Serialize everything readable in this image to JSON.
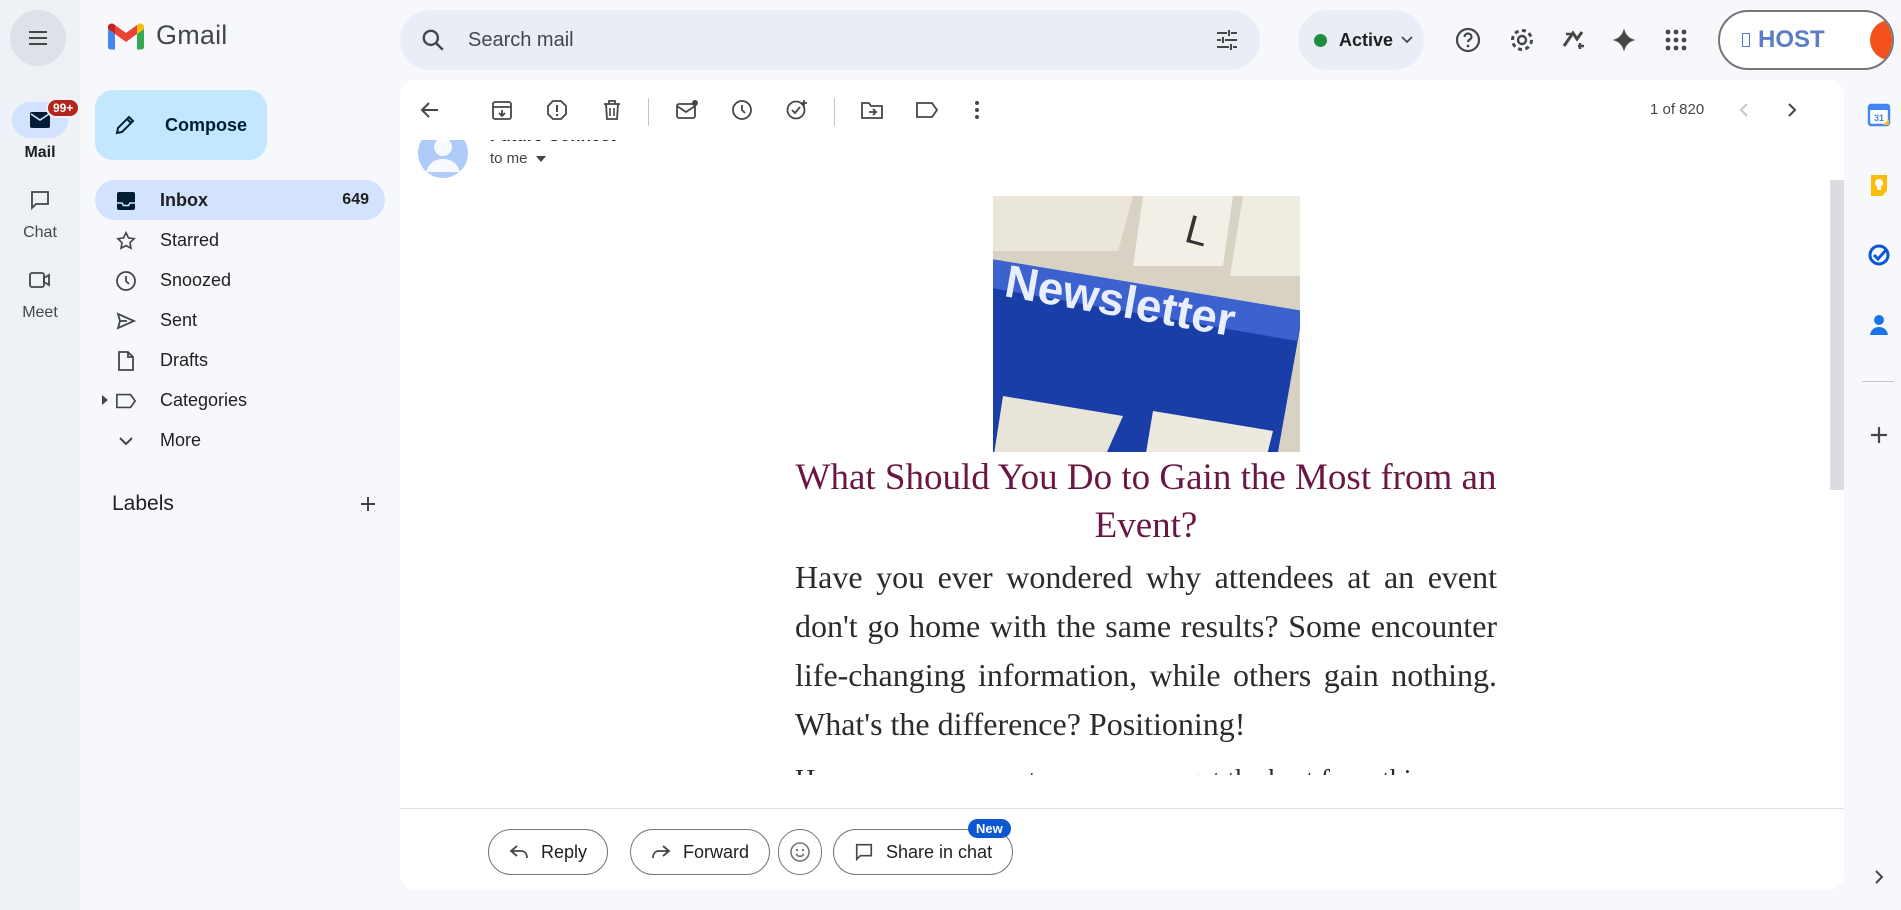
{
  "app": {
    "logo_text": "Gmail"
  },
  "rail": {
    "badge": "99+",
    "items": [
      {
        "label": "Mail",
        "icon": "mail-icon"
      },
      {
        "label": "Chat",
        "icon": "chat-icon"
      },
      {
        "label": "Meet",
        "icon": "video-icon"
      }
    ]
  },
  "search": {
    "placeholder": "Search mail"
  },
  "status": {
    "label": "Active",
    "color": "#1e8e3e"
  },
  "header_icons": [
    "help-icon",
    "gear-icon",
    "addon-icon",
    "gemini-icon",
    "apps-grid-icon"
  ],
  "host": {
    "label": "HOST"
  },
  "compose": {
    "label": "Compose"
  },
  "nav": {
    "items": [
      {
        "label": "Inbox",
        "count": "649",
        "icon": "inbox-icon"
      },
      {
        "label": "Starred",
        "count": "",
        "icon": "star-icon"
      },
      {
        "label": "Snoozed",
        "count": "",
        "icon": "clock-icon"
      },
      {
        "label": "Sent",
        "count": "",
        "icon": "send-icon"
      },
      {
        "label": "Drafts",
        "count": "",
        "icon": "draft-icon"
      },
      {
        "label": "Categories",
        "count": "",
        "icon": "label-icon"
      },
      {
        "label": "More",
        "count": "",
        "icon": "chevron-down-icon"
      }
    ]
  },
  "labels": {
    "heading": "Labels"
  },
  "toolbar": {
    "icons": [
      "back-arrow-icon",
      "archive-icon",
      "report-spam-icon",
      "delete-icon",
      "mark-unread-icon",
      "snooze-icon",
      "add-task-icon",
      "move-to-icon",
      "label-icon",
      "more-vert-icon"
    ],
    "pager": "1 of 820"
  },
  "email": {
    "sender": "Future Connect",
    "to": "to me",
    "image_text": "Newsletter",
    "title": "What Should You Do to Gain the Most from an Event?",
    "body": "Have you ever wondered why attendees at an event don't go home with the same results? Some encounter life-changing information, while others gain nothing. What's the difference? Positioning!",
    "next_line": "Here are some ways to ensure you get the best from this event:"
  },
  "actions": {
    "reply": "Reply",
    "forward": "Forward",
    "share": "Share in chat",
    "new_badge": "New"
  },
  "right_rail": [
    "calendar-icon",
    "keep-icon",
    "tasks-icon",
    "contacts-icon",
    "add-icon",
    "expand-icon"
  ],
  "colors": {
    "accent": "#0b57d0",
    "compose_bg": "#c2e7ff",
    "selected_bg": "#d3e3fd",
    "title_color": "#6b1743"
  }
}
